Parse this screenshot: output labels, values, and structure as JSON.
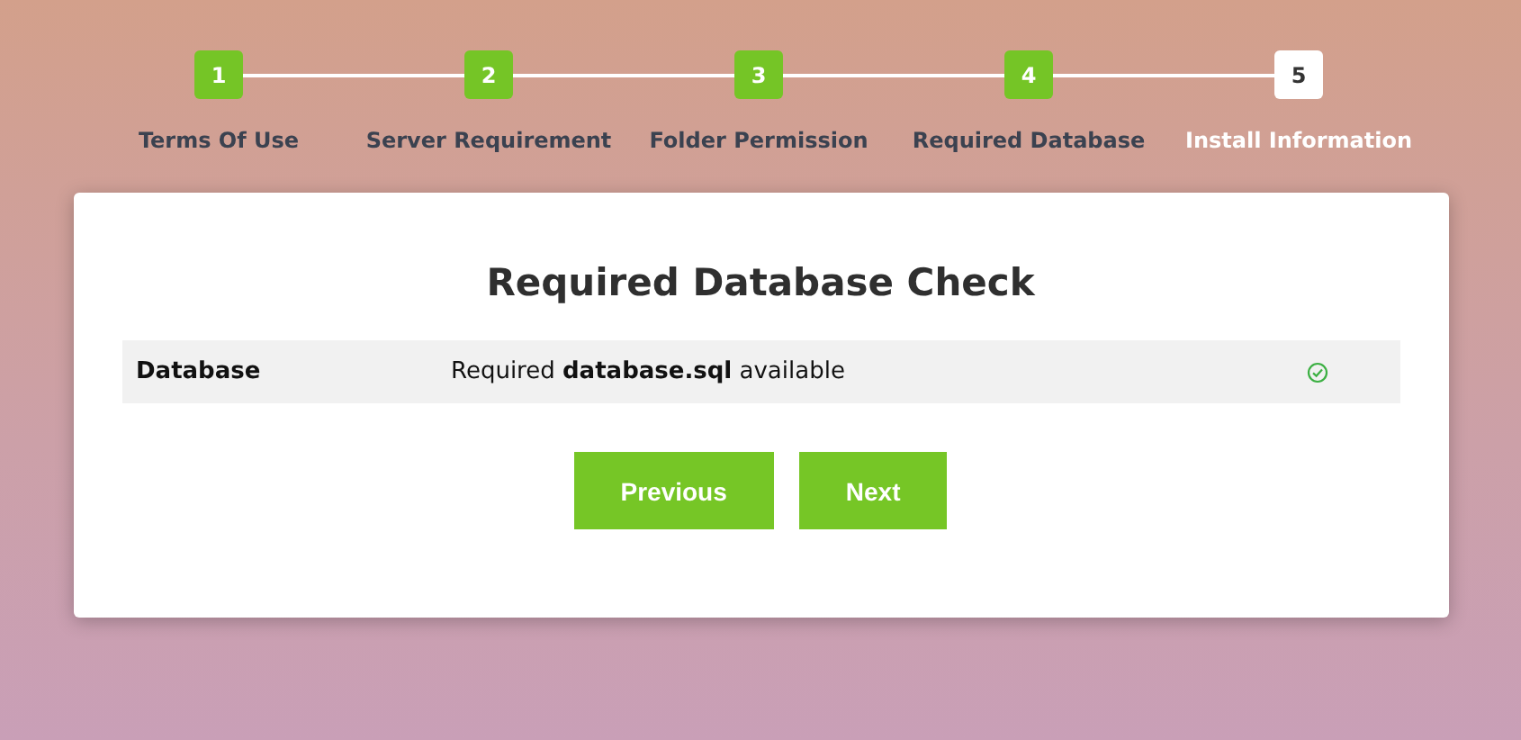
{
  "steps": [
    {
      "number": "1",
      "label": "Terms Of Use",
      "completed": true
    },
    {
      "number": "2",
      "label": "Server Requirement",
      "completed": true
    },
    {
      "number": "3",
      "label": "Folder Permission",
      "completed": true
    },
    {
      "number": "4",
      "label": "Required Database",
      "completed": true
    },
    {
      "number": "5",
      "label": "Install Information",
      "completed": false
    }
  ],
  "card": {
    "title": "Required Database Check",
    "rows": [
      {
        "name": "Database",
        "message": "Required **database.sql** available",
        "ok": true
      }
    ],
    "buttons": [
      "Previous",
      "Next"
    ]
  }
}
